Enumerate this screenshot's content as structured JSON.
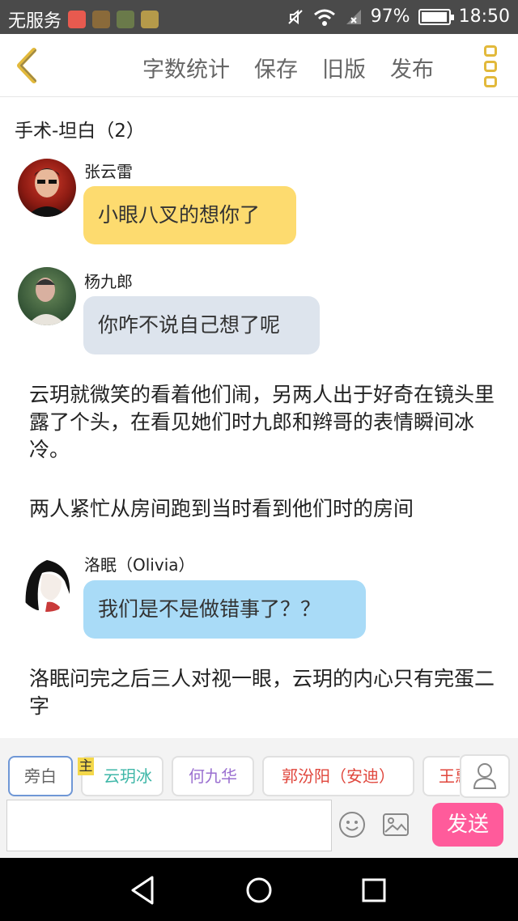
{
  "status_bar": {
    "carrier": "无服务",
    "battery_percent": "97%",
    "battery_level": 0.97,
    "time": "18:50"
  },
  "header": {
    "menu": [
      "字数统计",
      "保存",
      "旧版",
      "发布"
    ]
  },
  "document": {
    "title": "手术-坦白（2）"
  },
  "messages": [
    {
      "speaker": "张云雷",
      "text": "小眼八叉的想你了",
      "bubble_color": "#fddb6f"
    },
    {
      "speaker": "杨九郎",
      "text": "你咋不说自己想了呢",
      "bubble_color": "#dde4ed"
    },
    {
      "narration": "云玥就微笑的看着他们闹，另两人出于好奇在镜头里露了个头，在看见她们时九郎和辫哥的表情瞬间冰冷。"
    },
    {
      "narration": "两人紧忙从房间跑到当时看到他们时的房间"
    },
    {
      "speaker": "洛眠（Olivia）",
      "text": "我们是不是做错事了？？",
      "bubble_color": "#a9dbf7"
    },
    {
      "narration": "洛眠问完之后三人对视一眼，云玥的内心只有完蛋二字"
    }
  ],
  "composer": {
    "characters": [
      {
        "name": "旁白",
        "color": "#666666"
      },
      {
        "name": "云玥冰",
        "color": "#3fb7a8"
      },
      {
        "name": "何九华",
        "color": "#9a6fd0"
      },
      {
        "name": "郭汾阳（安迪）",
        "color": "#e0463c"
      },
      {
        "name": "王惠",
        "color": "#e0463c"
      }
    ],
    "host_badge": "主",
    "input_value": "",
    "send_label": "发送"
  },
  "colors": {
    "accent": "#e2b93b",
    "send": "#ff5b9b"
  }
}
